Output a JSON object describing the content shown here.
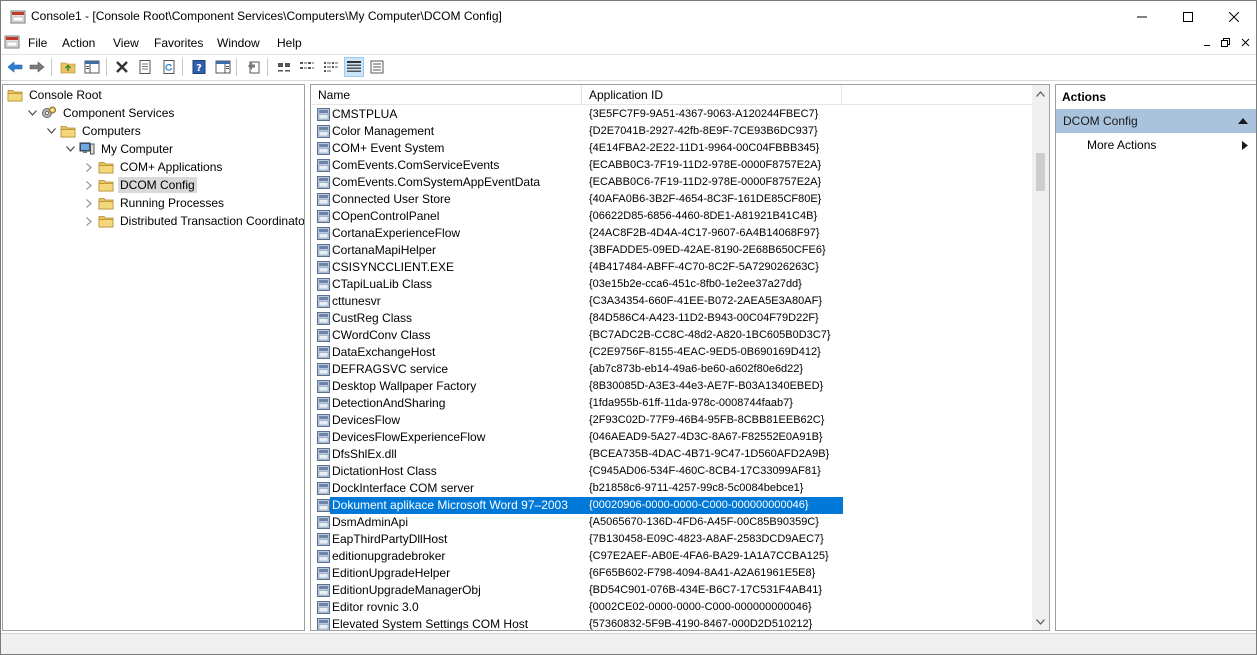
{
  "window": {
    "title": "Console1 - [Console Root\\Component Services\\Computers\\My Computer\\DCOM Config]"
  },
  "menu": {
    "file": "File",
    "action": "Action",
    "view": "View",
    "favorites": "Favorites",
    "window": "Window",
    "help": "Help"
  },
  "toolbar": {
    "icons": [
      "back-arrow-icon",
      "forward-arrow-icon",
      "up-folder-icon",
      "show-hide-tree-icon",
      "delete-icon",
      "properties-icon",
      "refresh-icon",
      "help-icon",
      "show-hide-action-pane-icon",
      "export-list-icon",
      "large-icons-view-icon",
      "small-icons-view-icon",
      "list-view-icon",
      "detail-view-icon",
      "customize-view-icon"
    ],
    "active": "detail-view-icon"
  },
  "tree": {
    "nodes": [
      {
        "label": "Console Root",
        "icon": "folder-icon",
        "level": 0,
        "expander": "none",
        "selected": false
      },
      {
        "label": "Component Services",
        "icon": "component-services-icon",
        "level": 1,
        "expander": "expanded",
        "selected": false
      },
      {
        "label": "Computers",
        "icon": "folder-icon",
        "level": 2,
        "expander": "expanded",
        "selected": false
      },
      {
        "label": "My Computer",
        "icon": "computer-icon",
        "level": 3,
        "expander": "expanded",
        "selected": false
      },
      {
        "label": "COM+ Applications",
        "icon": "folder-icon",
        "level": 4,
        "expander": "collapsed",
        "selected": false
      },
      {
        "label": "DCOM Config",
        "icon": "folder-icon",
        "level": 4,
        "expander": "collapsed",
        "selected": true
      },
      {
        "label": "Running Processes",
        "icon": "folder-icon",
        "level": 4,
        "expander": "collapsed",
        "selected": false
      },
      {
        "label": "Distributed Transaction Coordinator",
        "icon": "folder-icon",
        "level": 4,
        "expander": "collapsed",
        "selected": false
      }
    ]
  },
  "list": {
    "columns": {
      "name": "Name",
      "app_id": "Application ID"
    },
    "selected_index": 23,
    "rows": [
      {
        "name": "CMSTPLUA",
        "app_id": "{3E5FC7F9-9A51-4367-9063-A120244FBEC7}"
      },
      {
        "name": "Color Management",
        "app_id": "{D2E7041B-2927-42fb-8E9F-7CE93B6DC937}"
      },
      {
        "name": "COM+ Event System",
        "app_id": "{4E14FBA2-2E22-11D1-9964-00C04FBBB345}"
      },
      {
        "name": "ComEvents.ComServiceEvents",
        "app_id": "{ECABB0C3-7F19-11D2-978E-0000F8757E2A}"
      },
      {
        "name": "ComEvents.ComSystemAppEventData",
        "app_id": "{ECABB0C6-7F19-11D2-978E-0000F8757E2A}"
      },
      {
        "name": "Connected User Store",
        "app_id": "{40AFA0B6-3B2F-4654-8C3F-161DE85CF80E}"
      },
      {
        "name": "COpenControlPanel",
        "app_id": "{06622D85-6856-4460-8DE1-A81921B41C4B}"
      },
      {
        "name": "CortanaExperienceFlow",
        "app_id": "{24AC8F2B-4D4A-4C17-9607-6A4B14068F97}"
      },
      {
        "name": "CortanaMapiHelper",
        "app_id": "{3BFADDE5-09ED-42AE-8190-2E68B650CFE6}"
      },
      {
        "name": "CSISYNCCLIENT.EXE",
        "app_id": "{4B417484-ABFF-4C70-8C2F-5A729026263C}"
      },
      {
        "name": "CTapiLuaLib Class",
        "app_id": "{03e15b2e-cca6-451c-8fb0-1e2ee37a27dd}"
      },
      {
        "name": "cttunesvr",
        "app_id": "{C3A34354-660F-41EE-B072-2AEA5E3A80AF}"
      },
      {
        "name": "CustReg Class",
        "app_id": "{84D586C4-A423-11D2-B943-00C04F79D22F}"
      },
      {
        "name": "CWordConv Class",
        "app_id": "{BC7ADC2B-CC8C-48d2-A820-1BC605B0D3C7}"
      },
      {
        "name": "DataExchangeHost",
        "app_id": "{C2E9756F-8155-4EAC-9ED5-0B690169D412}"
      },
      {
        "name": "DEFRAGSVC service",
        "app_id": "{ab7c873b-eb14-49a6-be60-a602f80e6d22}"
      },
      {
        "name": "Desktop Wallpaper Factory",
        "app_id": "{8B30085D-A3E3-44e3-AE7F-B03A1340EBED}"
      },
      {
        "name": "DetectionAndSharing",
        "app_id": "{1fda955b-61ff-11da-978c-0008744faab7}"
      },
      {
        "name": "DevicesFlow",
        "app_id": "{2F93C02D-77F9-46B4-95FB-8CBB81EEB62C}"
      },
      {
        "name": "DevicesFlowExperienceFlow",
        "app_id": "{046AEAD9-5A27-4D3C-8A67-F82552E0A91B}"
      },
      {
        "name": "DfsShlEx.dll",
        "app_id": "{BCEA735B-4DAC-4B71-9C47-1D560AFD2A9B}"
      },
      {
        "name": "DictationHost Class",
        "app_id": "{C945AD06-534F-460C-8CB4-17C33099AF81}"
      },
      {
        "name": "DockInterface COM server",
        "app_id": "{b21858c6-9711-4257-99c8-5c0084bebce1}"
      },
      {
        "name": "Dokument aplikace Microsoft Word 97–2003",
        "app_id": "{00020906-0000-0000-C000-000000000046}"
      },
      {
        "name": "DsmAdminApi",
        "app_id": "{A5065670-136D-4FD6-A45F-00C85B90359C}"
      },
      {
        "name": "EapThirdPartyDllHost",
        "app_id": "{7B130458-E09C-4823-A8AF-2583DCD9AEC7}"
      },
      {
        "name": "editionupgradebroker",
        "app_id": "{C97E2AEF-AB0E-4FA6-BA29-1A1A7CCBA125}"
      },
      {
        "name": "EditionUpgradeHelper",
        "app_id": "{6F65B602-F798-4094-8A41-A2A61961E5E8}"
      },
      {
        "name": "EditionUpgradeManagerObj",
        "app_id": "{BD54C901-076B-434E-B6C7-17C531F4AB41}"
      },
      {
        "name": "Editor rovnic 3.0",
        "app_id": "{0002CE02-0000-0000-C000-000000000046}"
      },
      {
        "name": "Elevated System Settings COM Host",
        "app_id": "{57360832-5F9B-4190-8467-000D2D510212}"
      }
    ]
  },
  "actions": {
    "title": "Actions",
    "section": "DCOM Config",
    "more_actions": "More Actions"
  },
  "colors": {
    "selection": "#0078d7",
    "actions_header": "#a9c3dd",
    "folder": "#e8c35f"
  }
}
